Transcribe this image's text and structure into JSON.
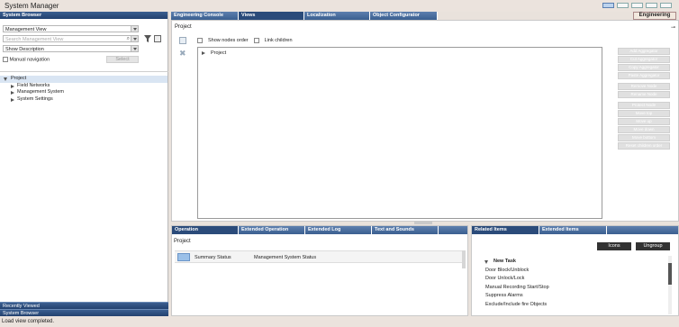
{
  "window": {
    "title": "System Manager"
  },
  "left": {
    "header": "System Browser",
    "view_select": "Management View",
    "search_placeholder": "Search Management View",
    "description_select": "Show Description",
    "manual_navigation": "Manual navigation",
    "select_button": "Select",
    "tree": [
      {
        "label": "Project",
        "expanded": true,
        "level": 0
      },
      {
        "label": "Field Networks",
        "expanded": false,
        "level": 1
      },
      {
        "label": "Management System",
        "expanded": false,
        "level": 1
      },
      {
        "label": "System Settings",
        "expanded": false,
        "level": 1
      }
    ],
    "bottom_bars": [
      "Recently Viewed",
      "System Browser"
    ]
  },
  "main_tabs": [
    "Engineering Console",
    "Views",
    "Localization",
    "Object Configurator"
  ],
  "engineering_button": "Engineering",
  "main": {
    "label": "Project",
    "show_nodes_order": "Show nodes order",
    "link_children": "Link children",
    "tree_root": "Project",
    "actions": [
      "Add Aggregator",
      "Cut Aggregator",
      "Copy Aggregator",
      "Paste Aggregator",
      "Remove Node",
      "Rename Node",
      "Protect Node",
      "Move top",
      "Move up",
      "Move down",
      "Move bottom",
      "Reset children order"
    ]
  },
  "bottom_left": {
    "tabs": [
      "Operation",
      "Extended Operation",
      "Extended Log",
      "Text and Sounds"
    ],
    "label": "Project",
    "row_label": "Summary Status",
    "row_value": "Management System Status"
  },
  "bottom_right": {
    "tabs": [
      "Related Items",
      "Extended Items"
    ],
    "icons_button": "Icons",
    "ungroup_button": "Ungroup",
    "group": "New Task",
    "items": [
      "Door Block/Unblock",
      "Door Unlock/Lock",
      "Manual Recording Start/Stop",
      "Suppress Alarms",
      "Exclude/Include fire Objects"
    ]
  },
  "status": "Load view completed."
}
